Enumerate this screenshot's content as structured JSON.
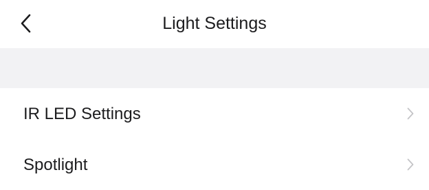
{
  "header": {
    "title": "Light Settings",
    "back_icon": "chevron-left-icon"
  },
  "settings_list": {
    "items": [
      {
        "label": "IR LED Settings",
        "icon": "chevron-right-icon"
      },
      {
        "label": "Spotlight",
        "icon": "chevron-right-icon"
      }
    ]
  },
  "colors": {
    "background": "#ffffff",
    "section_gap": "#f2f2f4",
    "text": "#1c1c1e",
    "chevron": "#c4c4c7"
  }
}
